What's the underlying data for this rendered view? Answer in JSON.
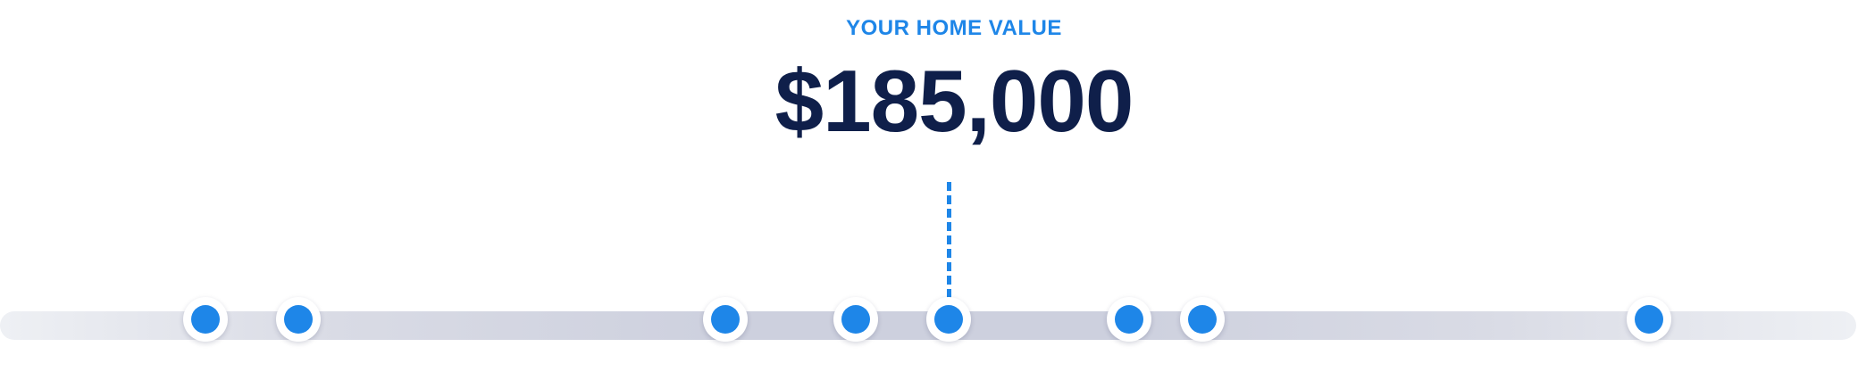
{
  "home_value": {
    "label": "YOUR HOME VALUE",
    "amount": "$185,000"
  },
  "colors": {
    "accent": "#1e86e8",
    "value_text": "#0f1f4a",
    "track": "#cdd0de",
    "dot_ring": "#ffffff"
  },
  "slider": {
    "point_count": 8,
    "selected_index": 4
  }
}
